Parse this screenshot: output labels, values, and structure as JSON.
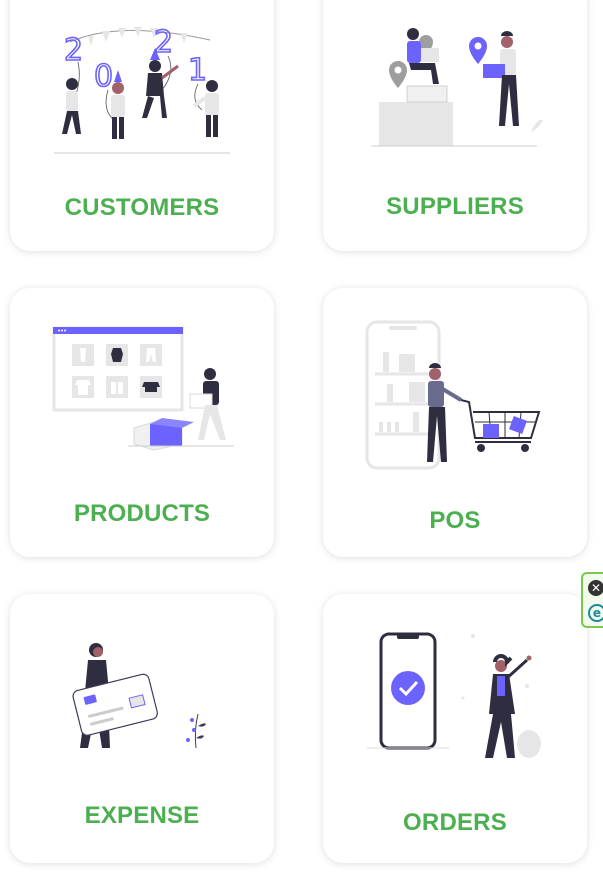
{
  "colors": {
    "label_green": "#4CAF50",
    "accent_purple": "#6C63FF",
    "ink": "#2F2E41",
    "light_gray": "#E6E6E6"
  },
  "cards": [
    {
      "label": "CUSTOMERS",
      "icon": "new-year-party-illustration"
    },
    {
      "label": "SUPPLIERS",
      "icon": "delivery-location-illustration"
    },
    {
      "label": "PRODUCTS",
      "icon": "online-store-illustration"
    },
    {
      "label": "POS",
      "icon": "shopping-cart-illustration"
    },
    {
      "label": "EXPENSE",
      "icon": "credit-card-illustration"
    },
    {
      "label": "ORDERS",
      "icon": "order-confirmed-illustration"
    }
  ],
  "widget": {
    "close_glyph": "✕",
    "logo_glyph": "e"
  }
}
